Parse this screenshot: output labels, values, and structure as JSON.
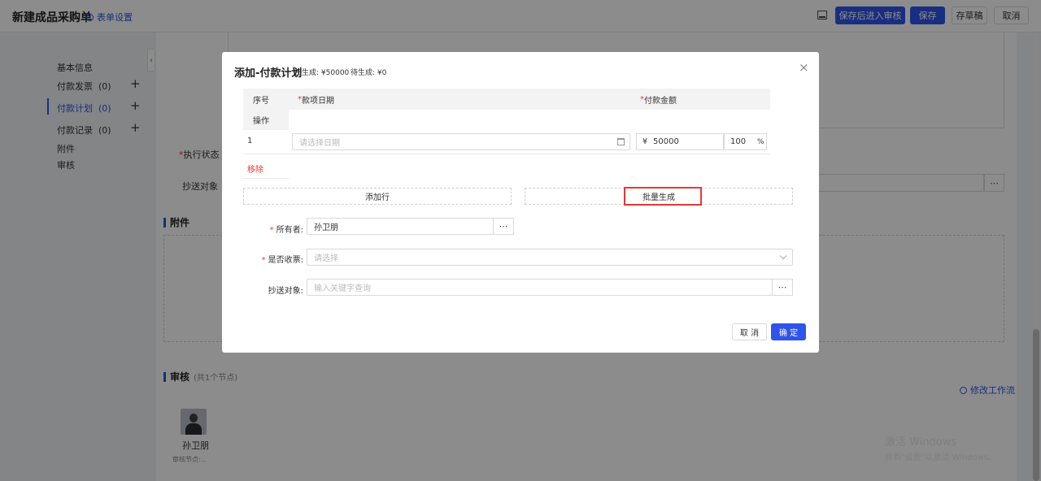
{
  "header": {
    "title": "新建成品采购单",
    "form_settings": "表单设置",
    "save_submit": "保存后进入审核",
    "save": "保存",
    "save_draft": "存草稿",
    "cancel": "取消"
  },
  "sidebar": {
    "items": [
      {
        "label": "基本信息"
      },
      {
        "label": "付款发票",
        "count": "(0)"
      },
      {
        "label": "付款计划",
        "count": "(0)"
      },
      {
        "label": "付款记录",
        "count": "(0)"
      },
      {
        "label": "附件"
      },
      {
        "label": "审核"
      }
    ]
  },
  "main": {
    "exec_status_label": "执行状态",
    "cc_label": "抄送对象",
    "attachment_title": "附件",
    "approval_title": "审核",
    "approval_sub": "(共1个节点)",
    "modify_flow": "修改工作流",
    "approver_name": "孙卫朋",
    "approver_node": "审核节点:..."
  },
  "watermark": {
    "line1": "激活 Windows",
    "line2": "转到\"设置\"以激活 Windows。"
  },
  "modal": {
    "title": "添加-付款计划",
    "generated_label": "已生成:",
    "generated_value": "¥50000",
    "pending_label": "待生成:",
    "pending_value": "¥0",
    "columns": {
      "index": "序号",
      "date": "款项日期",
      "amount": "付款金额",
      "action": "操作"
    },
    "row": {
      "index": "1",
      "date_placeholder": "请选择日期",
      "currency": "¥",
      "amount": "50000",
      "percent": "100",
      "percent_symbol": "%",
      "remove": "移除"
    },
    "add_row": "添加行",
    "batch_generate": "批量生成",
    "owner_label": "所有者:",
    "owner_value": "孙卫朋",
    "invoice_label": "是否收票:",
    "invoice_placeholder": "请选择",
    "cc_label": "抄送对象:",
    "cc_placeholder": "输入关键字查询",
    "cancel": "取 消",
    "confirm": "确 定"
  }
}
